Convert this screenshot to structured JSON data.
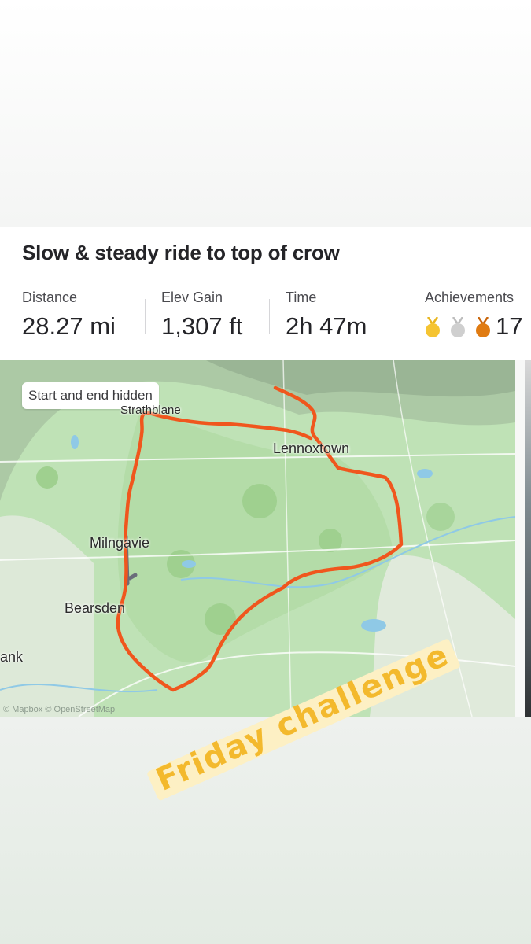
{
  "activity": {
    "title": "Slow & steady ride to top of crow",
    "stats": [
      {
        "label": "Distance",
        "value": "28.27 mi"
      },
      {
        "label": "Elev Gain",
        "value": "1,307 ft"
      },
      {
        "label": "Time",
        "value": "2h 47m"
      }
    ],
    "achievements": {
      "label": "Achievements",
      "count": "17",
      "medals": [
        "gold-medal-icon",
        "silver-medal-icon",
        "bronze-medal-icon"
      ]
    }
  },
  "map": {
    "privacy_label": "Start and end hidden",
    "places": [
      "Strathblane",
      "Lennoxtown",
      "Milngavie",
      "Bearsden",
      "ank"
    ],
    "attribution": "© Mapbox © OpenStreetMap",
    "route_color": "#f0561d"
  },
  "sticker": {
    "text": "Friday challenge",
    "color": "#f3b92d"
  }
}
